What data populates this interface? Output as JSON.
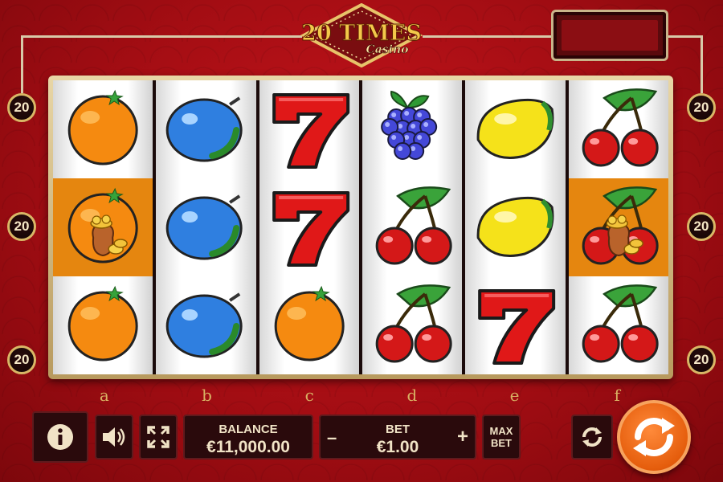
{
  "logo": {
    "title": "20 TIMES",
    "subtitle": "Casino"
  },
  "paylines": {
    "left": [
      "20",
      "20",
      "20"
    ],
    "right": [
      "20",
      "20",
      "20"
    ]
  },
  "reels": [
    {
      "letter": "a",
      "symbols": [
        "orange",
        "orange-gold",
        "orange"
      ]
    },
    {
      "letter": "b",
      "symbols": [
        "plum",
        "plum",
        "plum"
      ]
    },
    {
      "letter": "c",
      "symbols": [
        "seven",
        "seven",
        "orange"
      ]
    },
    {
      "letter": "d",
      "symbols": [
        "grapes",
        "cherries",
        "cherries"
      ]
    },
    {
      "letter": "e",
      "symbols": [
        "lemon",
        "lemon",
        "seven"
      ]
    },
    {
      "letter": "f",
      "symbols": [
        "cherries",
        "cherries-gold",
        "cherries"
      ]
    }
  ],
  "controls": {
    "balance_label": "BALANCE",
    "balance_value": "€11,000.00",
    "bet_label": "BET",
    "bet_value": "€1.00",
    "minus": "–",
    "plus": "+",
    "max_bet": "MAX\nBET"
  },
  "icons": [
    "info-icon",
    "sound-icon",
    "fullscreen-icon",
    "autoplay-icon",
    "spin-icon"
  ],
  "colors": {
    "background": "#b5101a",
    "highlight": "#e5860f",
    "frame": "#d9b766",
    "spin": "#f07020"
  }
}
